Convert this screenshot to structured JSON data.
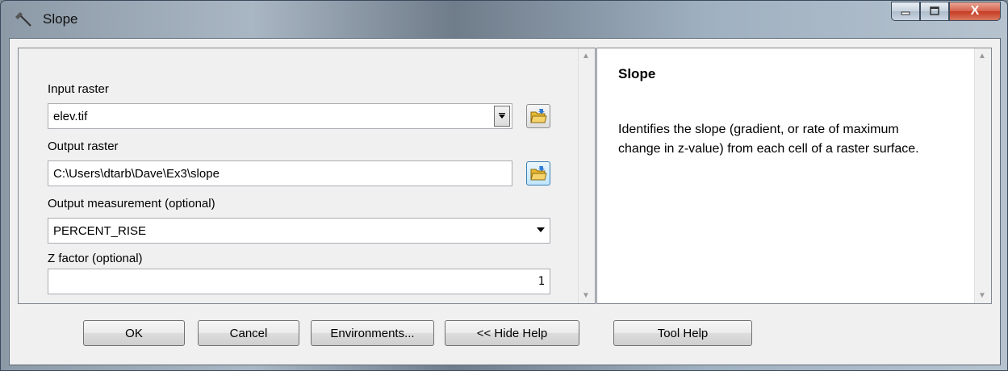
{
  "window": {
    "title": "Slope",
    "close_glyph": "X",
    "title_icon": "hammer-icon"
  },
  "params": {
    "input_raster": {
      "label": "Input raster",
      "value": "elev.tif"
    },
    "output_raster": {
      "label": "Output raster",
      "value": "C:\\Users\\dtarb\\Dave\\Ex3\\slope"
    },
    "output_measurement": {
      "label": "Output measurement (optional)",
      "value": "PERCENT_RISE"
    },
    "z_factor": {
      "label": "Z factor (optional)",
      "value": "1"
    }
  },
  "help": {
    "title": "Slope",
    "body": "Identifies the slope (gradient, or rate of maximum change in z-value) from each cell of a raster surface."
  },
  "buttons": {
    "ok": "OK",
    "cancel": "Cancel",
    "environments": "Environments...",
    "hide_help": "<< Hide Help",
    "tool_help": "Tool Help"
  },
  "colors": {
    "title_bar": "#9fb0c0",
    "close_button": "#c53b22",
    "folder_icon": "#e8b92f"
  }
}
